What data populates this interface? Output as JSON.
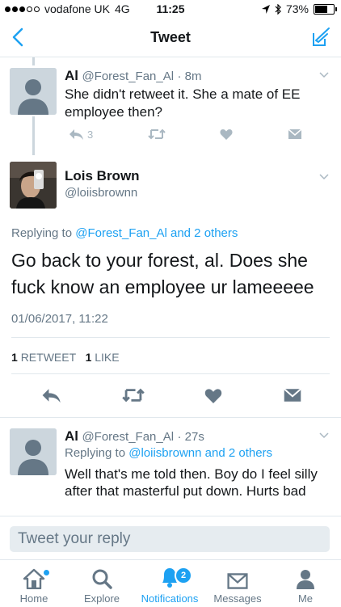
{
  "status_bar": {
    "carrier": "vodafone UK",
    "network": "4G",
    "time": "11:25",
    "battery": "73%",
    "battery_level": 0.73
  },
  "nav": {
    "title": "Tweet"
  },
  "reply1": {
    "name": "Al",
    "handle": "@Forest_Fan_Al",
    "time": "· 8m",
    "text": "She didn't retweet it.  She a mate of EE employee then?",
    "reply_count": "3"
  },
  "main": {
    "name": "Lois Brown",
    "handle": "@loiisbrownn",
    "replying_prefix": "Replying to ",
    "replying_to": "@Forest_Fan_Al and 2 others",
    "text": "Go back to your forest, al. Does she fuck know an employee ur lameeeee",
    "timestamp": "01/06/2017, 11:22",
    "retweets_count": "1",
    "retweets_label": "RETWEET",
    "likes_count": "1",
    "likes_label": "LIKE"
  },
  "reply2": {
    "name": "Al",
    "handle": "@Forest_Fan_Al",
    "time": "· 27s",
    "replying_prefix": "Replying to ",
    "replying_to": "@loiisbrownn and 2 others",
    "text": "Well that's me told then.  Boy do I feel silly after that masterful put down.  Hurts bad"
  },
  "reply_input": {
    "placeholder": "Tweet your reply"
  },
  "tabs": [
    {
      "label": "Home"
    },
    {
      "label": "Explore"
    },
    {
      "label": "Notifications",
      "badge": "2"
    },
    {
      "label": "Messages"
    },
    {
      "label": "Me"
    }
  ],
  "colors": {
    "accent": "#1da1f2",
    "icon_gray": "#657786",
    "light_gray": "#aab8c2"
  }
}
